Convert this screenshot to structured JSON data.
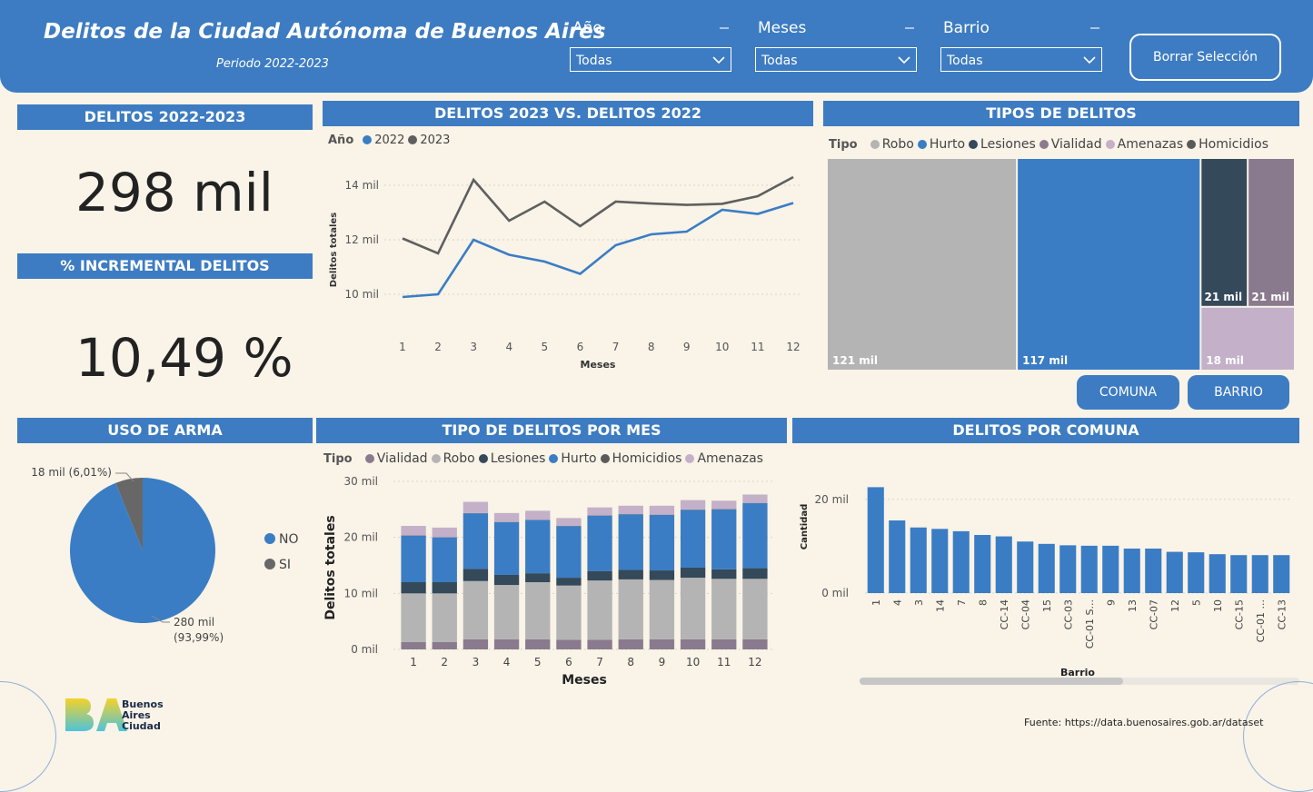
{
  "header": {
    "title": "Delitos de la Ciudad Autónoma de Buenos Aires",
    "subtitle": "Periodo 2022-2023",
    "filters": [
      {
        "label": "Año",
        "value": "Todas"
      },
      {
        "label": "Meses",
        "value": "Todas"
      },
      {
        "label": "Barrio",
        "value": "Todas"
      }
    ],
    "clear_button": "Borrar Selección"
  },
  "kpis": {
    "total_title": "DELITOS 2022-2023",
    "total_value": "298 mil",
    "incr_title": "% INCREMENTAL DELITOS",
    "incr_value": "10,49 %"
  },
  "buttons": {
    "comuna": "COMUNA",
    "barrio": "BARRIO"
  },
  "footer": {
    "source": "Fuente: https://data.buenosaires.gob.ar/dataset",
    "logo_line1": "Buenos",
    "logo_line2": "Aires",
    "logo_line3": "Ciudad"
  },
  "colors": {
    "blue": "#3a7dc4",
    "gray2023": "#5f5f5f",
    "robo": "#b4b4b4",
    "hurto": "#3a7dc4",
    "lesiones": "#34495a",
    "vialidad": "#8a7a8e",
    "amenazas": "#c4b0c8",
    "homicidios": "#5a5a5a",
    "arma_si": "#676767"
  },
  "chart_data": [
    {
      "id": "line",
      "type": "line",
      "title": "DELITOS 2023 VS. DELITOS 2022",
      "legend_title": "Año",
      "xlabel": "Meses",
      "ylabel": "Delitos totales",
      "x": [
        1,
        2,
        3,
        4,
        5,
        6,
        7,
        8,
        9,
        10,
        11,
        12
      ],
      "yticks": [
        {
          "v": 10000,
          "label": "10 mil"
        },
        {
          "v": 12000,
          "label": "12 mil"
        },
        {
          "v": 14000,
          "label": "14 mil"
        }
      ],
      "ylim": [
        8800,
        14800
      ],
      "series": [
        {
          "name": "2022",
          "color": "#3a7dc4",
          "values": [
            9900,
            10000,
            12000,
            11450,
            11200,
            10750,
            11800,
            12200,
            12300,
            13100,
            12950,
            13350
          ]
        },
        {
          "name": "2023",
          "color": "#5f5f5f",
          "values": [
            12050,
            11500,
            14200,
            12700,
            13400,
            12500,
            13400,
            13330,
            13280,
            13320,
            13600,
            14300
          ]
        }
      ]
    },
    {
      "id": "treemap",
      "type": "treemap",
      "title": "TIPOS DE DELITOS",
      "legend_title": "Tipo",
      "categories": [
        "Robo",
        "Hurto",
        "Lesiones",
        "Vialidad",
        "Amenazas",
        "Homicidios"
      ],
      "colors": [
        "#b4b4b4",
        "#3a7dc4",
        "#34495a",
        "#8a7a8e",
        "#c4b0c8",
        "#5a5a5a"
      ],
      "values": [
        121000,
        117000,
        21000,
        21000,
        18000,
        500
      ],
      "labels": [
        "121 mil",
        "117 mil",
        "21 mil",
        "21 mil",
        "18 mil",
        ""
      ]
    },
    {
      "id": "pie",
      "type": "pie",
      "title": "USO DE ARMA",
      "categories": [
        "NO",
        "SI"
      ],
      "colors": [
        "#3a7dc4",
        "#676767"
      ],
      "values": [
        280,
        18
      ],
      "labels": [
        "280 mil (93,99%)",
        "18 mil (6,01%)"
      ],
      "label_lines": [
        [
          "280 mil",
          "(93,99%)"
        ],
        [
          "18 mil (6,01%)"
        ]
      ]
    },
    {
      "id": "stacked",
      "type": "bar",
      "stacked": true,
      "title": "TIPO DE DELITOS POR MES",
      "legend_title": "Tipo",
      "xlabel": "Meses",
      "ylabel": "Delitos totales",
      "categories": [
        "1",
        "2",
        "3",
        "4",
        "5",
        "6",
        "7",
        "8",
        "9",
        "10",
        "11",
        "12"
      ],
      "ylim": [
        0,
        30000
      ],
      "yticks": [
        {
          "v": 0,
          "label": "0 mil"
        },
        {
          "v": 10000,
          "label": "10 mil"
        },
        {
          "v": 20000,
          "label": "20 mil"
        },
        {
          "v": 30000,
          "label": "30 mil"
        }
      ],
      "series": [
        {
          "name": "Vialidad",
          "color": "#8a7a8e",
          "values": [
            1300,
            1300,
            1800,
            1800,
            1800,
            1700,
            1700,
            1800,
            1800,
            1800,
            1800,
            1800
          ]
        },
        {
          "name": "Robo",
          "color": "#b4b4b4",
          "values": [
            8700,
            8700,
            10400,
            9700,
            10200,
            9700,
            10600,
            10700,
            10600,
            11000,
            10800,
            10800
          ]
        },
        {
          "name": "Lesiones",
          "color": "#34495a",
          "values": [
            2000,
            2000,
            2200,
            1800,
            1600,
            1400,
            1700,
            1700,
            1700,
            1800,
            1700,
            1900
          ]
        },
        {
          "name": "Hurto",
          "color": "#3a7dc4",
          "values": [
            8300,
            8000,
            9900,
            9400,
            9500,
            9200,
            9900,
            9900,
            9900,
            10300,
            10700,
            11600
          ]
        },
        {
          "name": "Homicidios",
          "color": "#5a5a5a",
          "values": [
            50,
            50,
            50,
            50,
            50,
            50,
            50,
            50,
            50,
            50,
            50,
            50
          ]
        },
        {
          "name": "Amenazas",
          "color": "#c4b0c8",
          "values": [
            1700,
            1700,
            2000,
            1600,
            1600,
            1400,
            1400,
            1500,
            1600,
            1700,
            1500,
            1500
          ]
        }
      ]
    },
    {
      "id": "comuna",
      "type": "bar",
      "title": "DELITOS POR COMUNA",
      "xlabel": "Barrio",
      "ylabel": "Cantidad",
      "categories": [
        "1",
        "4",
        "3",
        "14",
        "7",
        "8",
        "CC-14",
        "CC-04",
        "15",
        "CC-03",
        "CC-01 S...",
        "9",
        "13",
        "CC-07",
        "12",
        "5",
        "10",
        "CC-15",
        "CC-01 ...",
        "CC-13"
      ],
      "values": [
        22600,
        15500,
        14000,
        13700,
        13200,
        12400,
        12100,
        11000,
        10500,
        10200,
        10100,
        10100,
        9500,
        9500,
        8800,
        8700,
        8300,
        8100,
        8100,
        8100
      ],
      "ylim": [
        0,
        25000
      ],
      "yticks": [
        {
          "v": 0,
          "label": "0 mil"
        },
        {
          "v": 20000,
          "label": "20 mil"
        }
      ],
      "color": "#3a7dc4"
    }
  ]
}
